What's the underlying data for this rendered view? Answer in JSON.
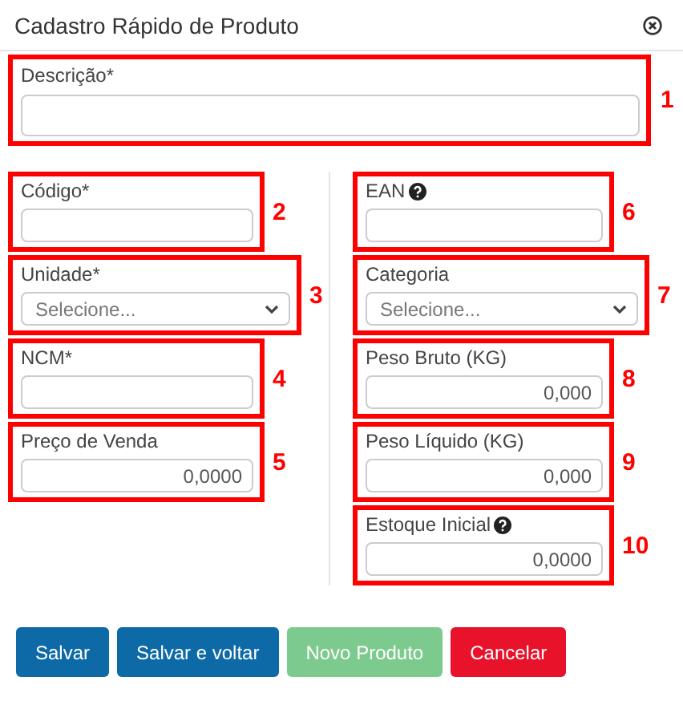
{
  "window": {
    "title": "Cadastro Rápido de Produto"
  },
  "top_field": {
    "label": "Descrição*",
    "kind": "text",
    "marker": "1"
  },
  "left_fields": [
    {
      "label": "Código*",
      "kind": "text",
      "marker": "2"
    },
    {
      "label": "Unidade*",
      "kind": "select",
      "placeholder": "Selecione...",
      "marker": "3"
    },
    {
      "label": "NCM*",
      "kind": "text",
      "marker": "4"
    },
    {
      "label": "Preço de Venda",
      "kind": "text",
      "value": "0,0000",
      "marker": "5"
    }
  ],
  "right_fields": [
    {
      "label": "EAN",
      "kind": "text",
      "help": true,
      "marker": "6"
    },
    {
      "label": "Categoria",
      "kind": "select",
      "placeholder": "Selecione...",
      "marker": "7"
    },
    {
      "label": "Peso Bruto (KG)",
      "kind": "text",
      "value": "0,000",
      "marker": "8"
    },
    {
      "label": "Peso Líquido (KG)",
      "kind": "text",
      "value": "0,000",
      "marker": "9"
    },
    {
      "label": "Estoque Inicial",
      "kind": "text",
      "help": true,
      "value": "0,0000",
      "marker": "10"
    }
  ],
  "buttons": [
    {
      "label": "Salvar",
      "kind": "primary",
      "disabled": false
    },
    {
      "label": "Salvar e voltar",
      "kind": "primary",
      "disabled": false
    },
    {
      "label": "Novo Produto",
      "kind": "success",
      "disabled": true
    },
    {
      "label": "Cancelar",
      "kind": "danger",
      "disabled": false
    }
  ]
}
